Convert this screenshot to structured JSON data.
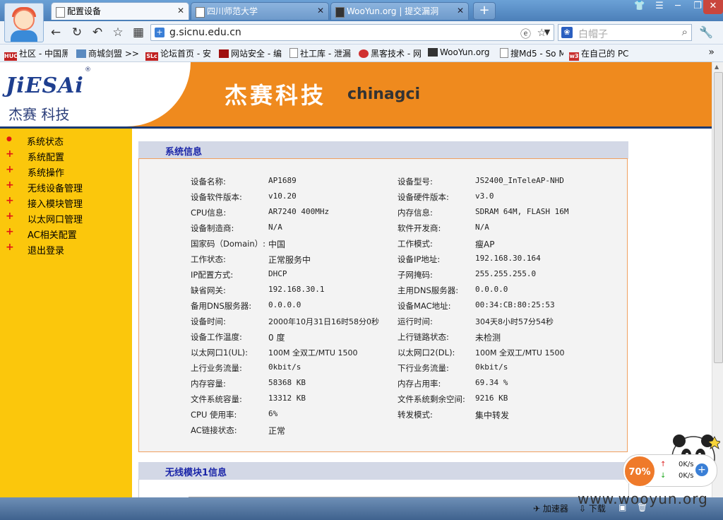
{
  "browser": {
    "tabs": [
      {
        "title": "配置设备",
        "active": true
      },
      {
        "title": "四川师范大学",
        "active": false
      },
      {
        "title": "WooYun.org | 提交漏洞",
        "active": false
      }
    ],
    "new_tab": "+",
    "url": "g.sicnu.edu.cn",
    "search_placeholder": "白帽子",
    "bookmarks": [
      {
        "label": "社区 - 中国黑",
        "icon": "HUC",
        "color": "#c02020"
      },
      {
        "label": "商城剑盟 >>",
        "icon": "",
        "color": "#5a8ac0"
      },
      {
        "label": "论坛首页 - 安",
        "icon": "SLc",
        "color": "#c02020"
      },
      {
        "label": "网站安全 - 编",
        "icon": "",
        "color": "#a01010"
      },
      {
        "label": "社工库 - 泄漏",
        "icon": "",
        "color": "#888888"
      },
      {
        "label": "黑客技术 - 网",
        "icon": "",
        "color": "#d03030"
      },
      {
        "label": "WooYun.org",
        "icon": "",
        "color": "#333333"
      },
      {
        "label": "搜Md5 - So M",
        "icon": "",
        "color": "#888888"
      },
      {
        "label": "在自己的 PC",
        "icon": "w3",
        "color": "#c83030"
      }
    ],
    "bookmarks_more": "»"
  },
  "header": {
    "logo_en": "JiESAi",
    "logo_cn": "杰赛 科技",
    "brand_cn": "杰赛科技",
    "brand_en": "chinagci"
  },
  "sidebar": {
    "items": [
      {
        "label": "系统状态",
        "symbol": "●"
      },
      {
        "label": "系统配置",
        "symbol": "+"
      },
      {
        "label": "系统操作",
        "symbol": "+"
      },
      {
        "label": "无线设备管理",
        "symbol": "+"
      },
      {
        "label": "接入模块管理",
        "symbol": "+"
      },
      {
        "label": "以太网口管理",
        "symbol": "+"
      },
      {
        "label": "AC相关配置",
        "symbol": "+"
      },
      {
        "label": "退出登录",
        "symbol": "+"
      }
    ]
  },
  "system_info": {
    "title": "系统信息",
    "rows": [
      {
        "l1": "设备名称:",
        "v1": "AP1689",
        "l2": "设备型号:",
        "v2": "JS2400_InTeleAP-NHD"
      },
      {
        "l1": "设备软件版本:",
        "v1": "v10.20",
        "l2": "设备硬件版本:",
        "v2": "v3.0"
      },
      {
        "l1": "CPU信息:",
        "v1": "AR7240 400MHz",
        "l2": "内存信息:",
        "v2": "SDRAM 64M, FLASH 16M"
      },
      {
        "l1": "设备制造商:",
        "v1": "N/A",
        "l2": "软件开发商:",
        "v2": "N/A"
      },
      {
        "l1": "国家码（Domain）:",
        "v1": "中国",
        "l2": "工作模式:",
        "v2": "瘦AP"
      },
      {
        "l1": "工作状态:",
        "v1": "正常服务中",
        "l2": "设备IP地址:",
        "v2": "192.168.30.164"
      },
      {
        "l1": "IP配置方式:",
        "v1": "DHCP",
        "l2": "子网掩码:",
        "v2": "255.255.255.0"
      },
      {
        "l1": "缺省网关:",
        "v1": "192.168.30.1",
        "l2": "主用DNS服务器:",
        "v2": "0.0.0.0"
      },
      {
        "l1": "备用DNS服务器:",
        "v1": "0.0.0.0",
        "l2": "设备MAC地址:",
        "v2": "00:34:CB:80:25:53"
      },
      {
        "l1": "设备时间:",
        "v1": "2000年10月31日16时58分0秒",
        "l2": "运行时间:",
        "v2": "304天8小时57分54秒"
      },
      {
        "l1": "设备工作温度:",
        "v1": "0 度",
        "l2": "上行链路状态:",
        "v2": "未检测"
      },
      {
        "l1": "以太网口1(UL):",
        "v1": "100M 全双工/MTU 1500",
        "l2": "以太网口2(DL):",
        "v2": "100M 全双工/MTU 1500"
      },
      {
        "l1": "上行业务流量:",
        "v1": "0kbit/s",
        "l2": "下行业务流量:",
        "v2": "0kbit/s"
      },
      {
        "l1": "内存容量:",
        "v1": "58368 KB",
        "l2": "内存占用率:",
        "v2": "69.34 %"
      },
      {
        "l1": "文件系统容量:",
        "v1": "13312 KB",
        "l2": "文件系统剩余空间:",
        "v2": "9216 KB"
      },
      {
        "l1": "CPU 使用率:",
        "v1": "6%",
        "l2": "转发模式:",
        "v2": "集中转发"
      },
      {
        "l1": "AC链接状态:",
        "v1": "正常",
        "l2": "",
        "v2": ""
      }
    ]
  },
  "wireless_info": {
    "title": "无线模块1信息"
  },
  "overlay": {
    "speed_percent": "70%",
    "upload": "0K/s",
    "download": "0K/s",
    "accelerator": "加速器",
    "download_label": "下载",
    "watermark": "www.wooyun.org"
  }
}
